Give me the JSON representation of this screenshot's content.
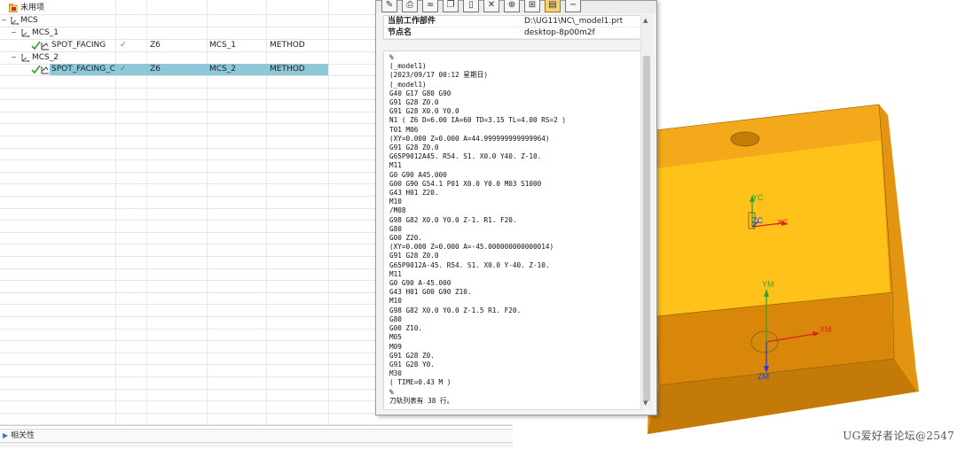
{
  "tree": {
    "rows": [
      {
        "kind": "unused",
        "name": "未用项"
      },
      {
        "kind": "root",
        "name": "MCS"
      },
      {
        "kind": "group",
        "name": "MCS_1"
      },
      {
        "kind": "op",
        "name": "SPOT_FACING",
        "check": "✓",
        "tool": "Z6",
        "geometry": "MCS_1",
        "method": "METHOD"
      },
      {
        "kind": "group",
        "name": "MCS_2"
      },
      {
        "kind": "op",
        "name": "SPOT_FACING_C...",
        "check": "✓",
        "tool": "Z6",
        "geometry": "MCS_2",
        "method": "METHOD",
        "selected": true
      }
    ],
    "relations_panel": "相关性",
    "colors": {
      "selected": "#8cc8d8",
      "check": "#2ca02c"
    }
  },
  "dialog": {
    "info": [
      {
        "key": "当前工作部件",
        "value": "D:\\UG11\\NC\\_model1.prt"
      },
      {
        "key": "节点名",
        "value": "desktop-8p00m2f"
      }
    ],
    "toolbar_icons": [
      "edit-icon",
      "print-icon",
      "binoculars-icon",
      "copy-icon",
      "page-icon",
      "close-icon",
      "target-icon",
      "tree-icon",
      "listing-icon",
      "minimize-icon"
    ],
    "listing": [
      "%",
      "(_model1)",
      "(2023/09/17 00:12 星期日)",
      "(_model1)",
      "G40 G17 G80 G90",
      "G91 G28 Z0.0",
      "G91 G28 X0.0 Y0.0",
      "N1 ( Z6 D=6.00 IA=60 TD=3.15 TL=4.00 RS=2 )",
      "T01 M06",
      "(XY=0.000 Z=0.000 A=44.999999999999964)",
      "G91 G28 Z0.0",
      "G65P9012A45. R54. S1. X0.0 Y40. Z-10.",
      "M11",
      "G0 G90 A45.000",
      "G00 G90 G54.1 P01 X0.0 Y0.0 M03 S1000",
      "G43 H01 Z20.",
      "M10",
      "/M08",
      "G98 G82 X0.0 Y0.0 Z-1. R1. F20.",
      "G80",
      "G00 Z20.",
      "(XY=0.000 Z=0.000 A=-45.000000000000014)",
      "G91 G28 Z0.0",
      "G65P9012A-45. R54. S1. X0.0 Y-40. Z-10.",
      "M11",
      "G0 G90 A-45.000",
      "G43 H01 G00 G90 Z10.",
      "M10",
      "G98 G82 X0.0 Y0.0 Z-1.5 R1. F20.",
      "G80",
      "G00 Z10.",
      "M05",
      "M09",
      "G91 G28 Z0.",
      "G91 G28 Y0.",
      "M30",
      "( TIME=0.43 M )",
      "%",
      "刀轨列表有 38 行。"
    ]
  },
  "viewport": {
    "labels": {
      "yc": "YC",
      "zc": "ZC",
      "xc": "XC",
      "ym": "YM",
      "xm": "XM",
      "zm": "ZM"
    },
    "colors": {
      "top": "#ffc21a",
      "top_back": "#f3a91a",
      "front": "#d9870a",
      "left": "#e98a12",
      "right": "#e8990f",
      "axis_x": "#e02020",
      "axis_y": "#2ea52e",
      "axis_z": "#2040e0"
    },
    "watermark": "UG爱好者论坛@2547"
  }
}
